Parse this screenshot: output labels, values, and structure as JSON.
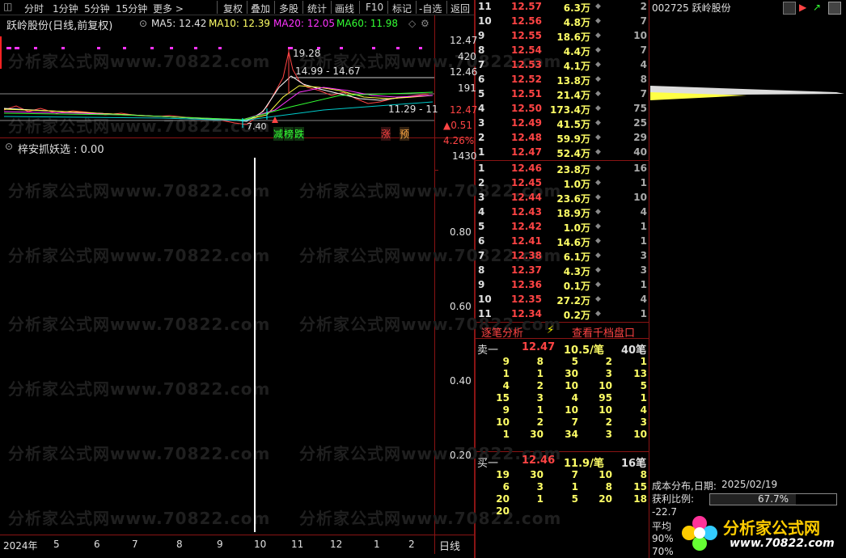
{
  "toolbar": {
    "items": [
      "分时",
      "1分钟",
      "5分钟",
      "15分钟",
      "更多 >",
      "复权",
      "叠加",
      "多股",
      "统计",
      "画线",
      "F10",
      "标记",
      "-自选",
      "返回"
    ]
  },
  "chart": {
    "title": "跃岭股份(日线,前复权)",
    "ma5": "MA5: 12.42",
    "ma10": "MA10: 12.39",
    "ma20": "MA20: 12.05",
    "ma60": "MA60: 11.98",
    "high_marker": "19.28",
    "range_label": "14.99 - 14.67",
    "low_range_label": "11.29 - 11",
    "low_marker": "7.40",
    "tags": [
      "减",
      "榜",
      "跌",
      "涨",
      "预"
    ],
    "price_axis": [
      "12.47",
      "420",
      "12.46",
      "191",
      "12.47",
      "▲0.51",
      "4.26%",
      "1430"
    ]
  },
  "indicator": {
    "title": "梓安抓妖选 : 0.00",
    "axis": [
      "0.80",
      "0.60",
      "0.40",
      "0.20"
    ]
  },
  "x_axis": {
    "labels": [
      "2024年",
      "5",
      "6",
      "7",
      "8",
      "9",
      "10",
      "11",
      "12",
      "1",
      "2"
    ],
    "period": "日线"
  },
  "order_book": {
    "asks": [
      {
        "lvl": "11",
        "price": "12.57",
        "vol": "6.3万",
        "cnt": "2"
      },
      {
        "lvl": "10",
        "price": "12.56",
        "vol": "4.8万",
        "cnt": "7"
      },
      {
        "lvl": "9",
        "price": "12.55",
        "vol": "18.6万",
        "cnt": "10"
      },
      {
        "lvl": "8",
        "price": "12.54",
        "vol": "4.4万",
        "cnt": "7"
      },
      {
        "lvl": "7",
        "price": "12.53",
        "vol": "4.1万",
        "cnt": "4"
      },
      {
        "lvl": "6",
        "price": "12.52",
        "vol": "13.8万",
        "cnt": "8"
      },
      {
        "lvl": "5",
        "price": "12.51",
        "vol": "21.4万",
        "cnt": "7"
      },
      {
        "lvl": "4",
        "price": "12.50",
        "vol": "173.4万",
        "cnt": "75"
      },
      {
        "lvl": "3",
        "price": "12.49",
        "vol": "41.5万",
        "cnt": "25"
      },
      {
        "lvl": "2",
        "price": "12.48",
        "vol": "59.9万",
        "cnt": "29"
      },
      {
        "lvl": "1",
        "price": "12.47",
        "vol": "52.4万",
        "cnt": "40"
      }
    ],
    "bids": [
      {
        "lvl": "1",
        "price": "12.46",
        "vol": "23.8万",
        "cnt": "16"
      },
      {
        "lvl": "2",
        "price": "12.45",
        "vol": "1.0万",
        "cnt": "1"
      },
      {
        "lvl": "3",
        "price": "12.44",
        "vol": "23.6万",
        "cnt": "10"
      },
      {
        "lvl": "4",
        "price": "12.43",
        "vol": "18.9万",
        "cnt": "4"
      },
      {
        "lvl": "5",
        "price": "12.42",
        "vol": "1.0万",
        "cnt": "1"
      },
      {
        "lvl": "6",
        "price": "12.41",
        "vol": "14.6万",
        "cnt": "1"
      },
      {
        "lvl": "7",
        "price": "12.38",
        "vol": "6.1万",
        "cnt": "3"
      },
      {
        "lvl": "8",
        "price": "12.37",
        "vol": "4.3万",
        "cnt": "3"
      },
      {
        "lvl": "9",
        "price": "12.36",
        "vol": "0.1万",
        "cnt": "1"
      },
      {
        "lvl": "10",
        "price": "12.35",
        "vol": "27.2万",
        "cnt": "4"
      },
      {
        "lvl": "11",
        "price": "12.34",
        "vol": "0.2万",
        "cnt": "1"
      }
    ],
    "tab_left": "逐笔分析",
    "tab_right": "查看千档盘口",
    "sell1": {
      "label": "卖一",
      "price": "12.47",
      "vol": "10.5/笔",
      "cnt": "40笔"
    },
    "sell_rows": [
      [
        "9",
        "8",
        "5",
        "2",
        "1"
      ],
      [
        "1",
        "1",
        "30",
        "3",
        "13"
      ],
      [
        "4",
        "2",
        "10",
        "10",
        "5"
      ],
      [
        "15",
        "3",
        "4",
        "95",
        "1"
      ],
      [
        "9",
        "1",
        "10",
        "10",
        "4"
      ],
      [
        "10",
        "2",
        "7",
        "2",
        "3"
      ],
      [
        "1",
        "30",
        "34",
        "3",
        "10"
      ]
    ],
    "buy1": {
      "label": "买一",
      "price": "12.46",
      "vol": "11.9/笔",
      "cnt": "16笔"
    },
    "buy_rows": [
      [
        "19",
        "30",
        "7",
        "10",
        "8"
      ],
      [
        "6",
        "3",
        "1",
        "8",
        "15"
      ],
      [
        "20",
        "1",
        "5",
        "20",
        "18"
      ],
      [
        "20",
        "",
        "",
        "",
        ""
      ]
    ]
  },
  "right_panel": {
    "stock": "002725 跃岭股份",
    "cost_title": "成本分布,日期:",
    "cost_date": "2025/02/19",
    "profit_label": "获利比例:",
    "profit_value": "67.7%",
    "profit_fraction": 0.677,
    "line3": "-22.7",
    "line4": "平均",
    "line5": "90%",
    "line6": "70%"
  },
  "logo": {
    "name": "分析家公式网",
    "url": "www.70822.com"
  },
  "colors": {
    "red": "#ff4444",
    "yellow": "#ffff66",
    "green": "#00ff00",
    "magenta": "#ff33ff",
    "cyan": "#00ffff",
    "frame": "#8a1414"
  }
}
